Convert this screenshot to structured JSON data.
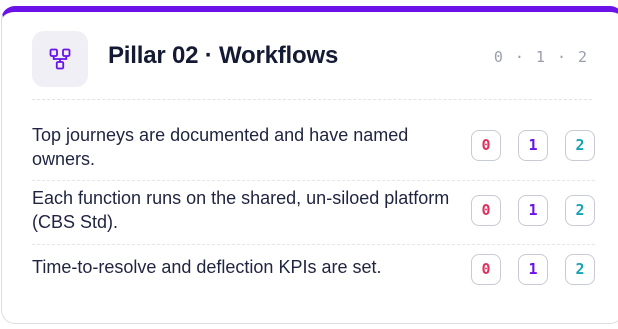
{
  "accent_color": "#6a12e8",
  "pillar": {
    "icon": "workflow-icon",
    "title": "Pillar 02 · Workflows",
    "scale": [
      "0",
      "1",
      "2"
    ],
    "scale_separator": "·"
  },
  "rating_colors": {
    "0": "#e0305e",
    "1": "#6a12e8",
    "2": "#17a3b5"
  },
  "questions": [
    {
      "text": "Top journeys are documented and have named owners.",
      "options": [
        "0",
        "1",
        "2"
      ]
    },
    {
      "text": "Each function runs on the shared, un-siloed platform (CBS Std).",
      "options": [
        "0",
        "1",
        "2"
      ]
    },
    {
      "text": "Time-to-resolve and deflection KPIs are set.",
      "options": [
        "0",
        "1",
        "2"
      ]
    }
  ]
}
